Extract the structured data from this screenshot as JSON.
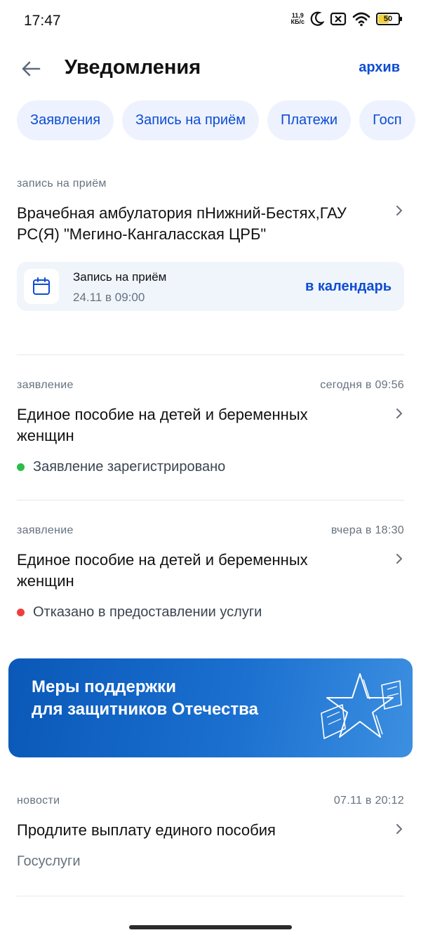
{
  "status_bar": {
    "time": "17:47",
    "net_speed_value": "11,9",
    "net_speed_unit": "КБ/с",
    "battery_level": "50",
    "battery_fraction": 0.5
  },
  "header": {
    "title": "Уведомления",
    "archive_label": "архив"
  },
  "filter_chips": [
    "Заявления",
    "Запись на приём",
    "Платежи",
    "Госп"
  ],
  "notifications": [
    {
      "category": "запись на приём",
      "time": "",
      "title": "Врачебная амбулатория пНижний-Бестях,ГАУ РС(Я) \"Мегино-Кангаласская ЦРБ\"",
      "appointment": {
        "label": "Запись на приём",
        "date": "24.11 в 09:00",
        "action": "в календарь"
      }
    },
    {
      "category": "заявление",
      "time": "сегодня в 09:56",
      "title": "Единое пособие на детей и беременных женщин",
      "status": {
        "text": "Заявление зарегистрировано",
        "color": "#2bbd48"
      }
    },
    {
      "category": "заявление",
      "time": "вчера в 18:30",
      "title": "Единое пособие на детей и беременных женщин",
      "status": {
        "text": "Отказано в предоставлении услуги",
        "color": "#ee3f3f"
      }
    },
    {
      "category": "новости",
      "time": "07.11 в 20:12",
      "title": "Продлите выплату единого пособия",
      "source": "Госуслуги"
    }
  ],
  "promo": {
    "line1": "Меры поддержки",
    "line2": "для защитников Отечества",
    "icon": "star-icon"
  },
  "colors": {
    "accent": "#0d4cd3",
    "chip_bg": "#edf2fe",
    "banner_start": "#0a58b8",
    "banner_end": "#3c8fe0"
  }
}
